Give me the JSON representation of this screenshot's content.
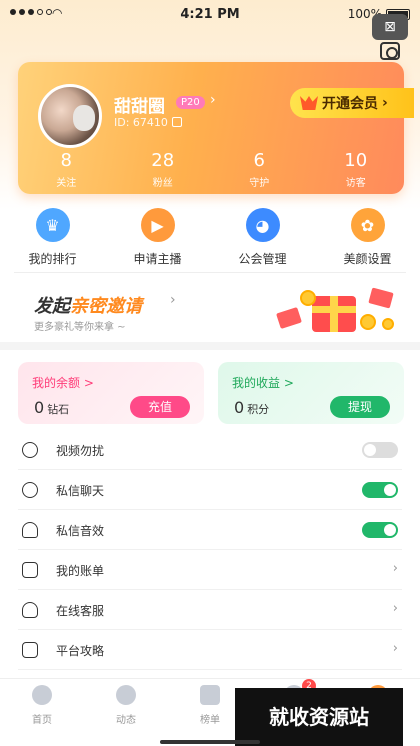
{
  "status": {
    "time": "4:21 PM",
    "battery": "100%"
  },
  "corner": {
    "close_glyph": "⊠"
  },
  "profile": {
    "name": "甜甜圈",
    "level": "P20",
    "id": "ID: 67410",
    "vip_label": "开通会员",
    "stats": [
      {
        "num": "8",
        "label": "关注"
      },
      {
        "num": "28",
        "label": "粉丝"
      },
      {
        "num": "6",
        "label": "守护"
      },
      {
        "num": "10",
        "label": "访客"
      }
    ]
  },
  "quick_actions": [
    "我的排行",
    "申请主播",
    "公会管理",
    "美颜设置"
  ],
  "invite": {
    "title_a": "发起",
    "title_b": "亲密邀请",
    "subtitle": "更多豪礼等你来拿 ~"
  },
  "wallet": {
    "balance": {
      "title": "我的余额 >",
      "value": "0",
      "unit": "钻石",
      "button": "充值"
    },
    "income": {
      "title": "我的收益 >",
      "value": "0",
      "unit": "积分",
      "button": "提现"
    }
  },
  "settings": [
    {
      "label": "视频勿扰",
      "toggle": false
    },
    {
      "label": "私信聊天",
      "toggle": true
    },
    {
      "label": "私信音效",
      "toggle": true
    },
    {
      "label": "我的账单"
    },
    {
      "label": "在线客服"
    },
    {
      "label": "平台攻略"
    }
  ],
  "tabs": [
    "首页",
    "动态",
    "榜单",
    "",
    ""
  ],
  "tab_badge": "2",
  "watermark": "就收资源站",
  "colors": {
    "accent_orange": "#ffb04d",
    "pink": "#ff4a88",
    "green": "#21b76a"
  }
}
